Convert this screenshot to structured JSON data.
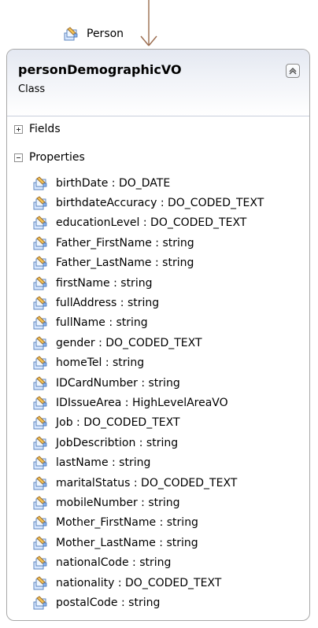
{
  "inheritance": {
    "parent_name": "Person",
    "icon_name": "class-icon"
  },
  "class_box": {
    "name": "personDemographicVO",
    "stereotype": "Class",
    "collapse_icon": "collapse-icon"
  },
  "compartments": {
    "fields": {
      "label": "Fields",
      "state": "collapsed"
    },
    "properties": {
      "label": "Properties",
      "state": "expanded"
    }
  },
  "properties": [
    {
      "text": "birthDate : DO_DATE",
      "icon": "property-icon"
    },
    {
      "text": "birthdateAccuracy : DO_CODED_TEXT",
      "icon": "property-icon"
    },
    {
      "text": "educationLevel : DO_CODED_TEXT",
      "icon": "property-icon"
    },
    {
      "text": "Father_FirstName : string",
      "icon": "property-icon"
    },
    {
      "text": "Father_LastName : string",
      "icon": "property-icon"
    },
    {
      "text": "firstName : string",
      "icon": "property-icon"
    },
    {
      "text": "fullAddress : string",
      "icon": "property-icon"
    },
    {
      "text": "fullName : string",
      "icon": "property-icon"
    },
    {
      "text": "gender : DO_CODED_TEXT",
      "icon": "property-icon"
    },
    {
      "text": "homeTel : string",
      "icon": "property-icon"
    },
    {
      "text": "IDCardNumber : string",
      "icon": "property-icon"
    },
    {
      "text": "IDIssueArea : HighLevelAreaVO",
      "icon": "property-icon"
    },
    {
      "text": "Job : DO_CODED_TEXT",
      "icon": "property-icon"
    },
    {
      "text": "JobDescribtion : string",
      "icon": "property-icon"
    },
    {
      "text": "lastName : string",
      "icon": "property-icon"
    },
    {
      "text": "maritalStatus : DO_CODED_TEXT",
      "icon": "property-icon"
    },
    {
      "text": "mobileNumber : string",
      "icon": "property-icon"
    },
    {
      "text": "Mother_FirstName : string",
      "icon": "property-icon"
    },
    {
      "text": "Mother_LastName : string",
      "icon": "property-icon"
    },
    {
      "text": "nationalCode : string",
      "icon": "property-icon"
    },
    {
      "text": "nationality : DO_CODED_TEXT",
      "icon": "property-icon"
    },
    {
      "text": "postalCode : string",
      "icon": "property-icon"
    }
  ]
}
